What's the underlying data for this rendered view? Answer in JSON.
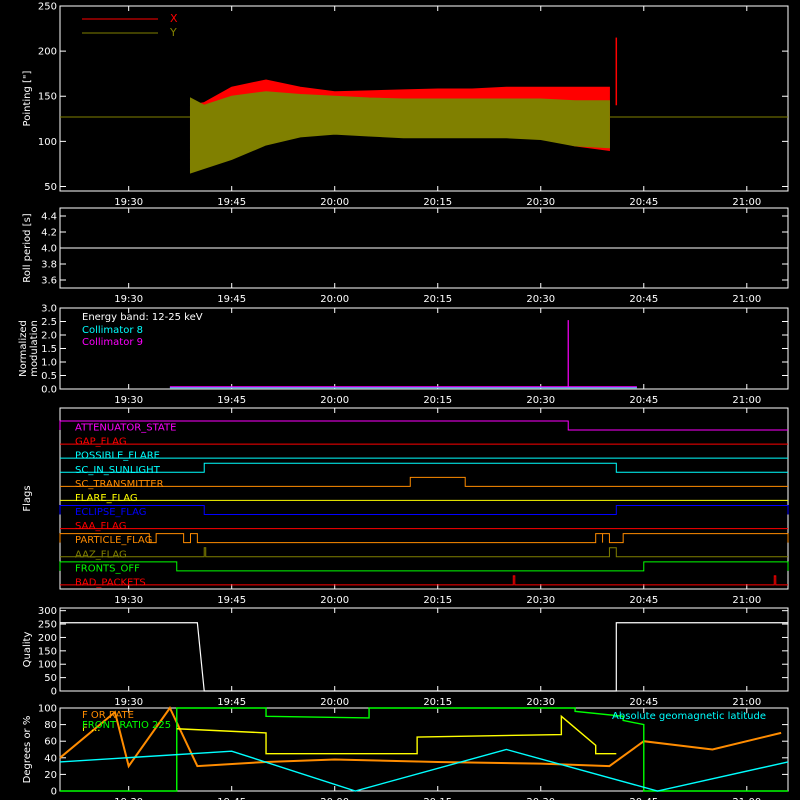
{
  "colors": {
    "background": "#000000",
    "axes": "#ffffff",
    "x": "#ff0000",
    "y": "#808000",
    "cyan": "#00ffff",
    "magenta": "#ff00ff",
    "red": "#ff0000",
    "orange": "#ff8c00",
    "yellow": "#ffff00",
    "blue": "#0000ff",
    "green": "#00ff00",
    "olive": "#808000"
  },
  "chart_data": [
    {
      "type": "area",
      "ylabel": "Pointing [\"]",
      "xlim": [
        "19:20",
        "21:06"
      ],
      "ylim": [
        45,
        250
      ],
      "xticks": [
        "19:30",
        "19:45",
        "20:00",
        "20:15",
        "20:30",
        "20:45",
        "21:00"
      ],
      "yticks": [
        50,
        100,
        150,
        200,
        250
      ],
      "legend": [
        "X",
        "Y"
      ],
      "reference_line": 127,
      "series": [
        {
          "name": "X",
          "color": "#ff0000",
          "x": [
            "19:39",
            "19:41",
            "19:45",
            "19:50",
            "19:55",
            "20:00",
            "20:05",
            "20:10",
            "20:15",
            "20:20",
            "20:25",
            "20:30",
            "20:35",
            "20:40"
          ],
          "upper": [
            140,
            143,
            160,
            168,
            160,
            155,
            156,
            157,
            158,
            158,
            160,
            160,
            160,
            160
          ],
          "lower": [
            75,
            73,
            90,
            102,
            108,
            110,
            108,
            106,
            106,
            106,
            106,
            104,
            95,
            90
          ]
        },
        {
          "name": "Y",
          "color": "#808000",
          "x": [
            "19:39",
            "19:41",
            "19:45",
            "19:50",
            "19:55",
            "20:00",
            "20:05",
            "20:10",
            "20:15",
            "20:20",
            "20:25",
            "20:30",
            "20:35",
            "20:40"
          ],
          "upper": [
            148,
            140,
            150,
            155,
            152,
            150,
            148,
            147,
            147,
            147,
            147,
            147,
            145,
            145
          ],
          "lower": [
            65,
            70,
            80,
            96,
            105,
            108,
            106,
            104,
            104,
            104,
            104,
            102,
            95,
            93
          ]
        }
      ],
      "spike": {
        "x": "20:41",
        "y": 215
      }
    },
    {
      "type": "line",
      "ylabel": "Roll period [s]",
      "xlim": [
        "19:20",
        "21:06"
      ],
      "ylim": [
        3.5,
        4.5
      ],
      "yticks": [
        "3.6",
        "3.8",
        "4.0",
        "4.2",
        "4.4"
      ],
      "xticks": [
        "19:30",
        "19:45",
        "20:00",
        "20:15",
        "20:30",
        "20:45",
        "21:00"
      ],
      "series": [
        {
          "x": [
            "19:20",
            "21:06"
          ],
          "y": [
            4.0,
            4.0
          ]
        }
      ]
    },
    {
      "type": "line",
      "ylabel": "Normalized modulation",
      "ylabel_lines": [
        "Normalized",
        "modulation"
      ],
      "xlim": [
        "19:20",
        "21:06"
      ],
      "ylim": [
        0,
        3.0
      ],
      "yticks": [
        "0.0",
        "0.5",
        "1.0",
        "1.5",
        "2.0",
        "2.5",
        "3.0"
      ],
      "xticks": [
        "19:30",
        "19:45",
        "20:00",
        "20:15",
        "20:30",
        "20:45",
        "21:00"
      ],
      "legend_title": "Energy band: 12-25 keV",
      "series": [
        {
          "name": "Collimator 8",
          "color": "#00ffff",
          "x": [
            "19:36",
            "20:44"
          ],
          "y": [
            0.05,
            0.05
          ]
        },
        {
          "name": "Collimator 9",
          "color": "#ff00ff",
          "x": [
            "19:36",
            "20:34",
            "20:34",
            "20:34",
            "20:44"
          ],
          "y": [
            0.08,
            0.08,
            2.55,
            0.08,
            0.08
          ]
        }
      ]
    },
    {
      "type": "line",
      "ylabel": "Flags",
      "xlim": [
        "19:20",
        "21:06"
      ],
      "xticks": [
        "19:30",
        "19:45",
        "20:00",
        "20:15",
        "20:30",
        "20:45",
        "21:00"
      ],
      "series": [
        {
          "name": "ATTENUATOR_STATE",
          "color": "#ff00ff",
          "on": [
            [
              "19:20",
              "20:34"
            ]
          ]
        },
        {
          "name": "GAP_FLAG",
          "color": "#ff0000",
          "on": []
        },
        {
          "name": "POSSIBLE_FLARE",
          "color": "#00ffff",
          "on": []
        },
        {
          "name": "SC_IN_SUNLIGHT",
          "color": "#00ffff",
          "on": [
            [
              "19:41",
              "20:41"
            ]
          ]
        },
        {
          "name": "SC_TRANSMITTER",
          "color": "#ff8c00",
          "on": [
            [
              "20:11",
              "20:19"
            ]
          ]
        },
        {
          "name": "FLARE_FLAG",
          "color": "#ffff00",
          "on": []
        },
        {
          "name": "ECLIPSE_FLAG",
          "color": "#0000ff",
          "on": [
            [
              "19:20",
              "19:41"
            ],
            [
              "20:41",
              "21:06"
            ]
          ]
        },
        {
          "name": "SAA_FLAG",
          "color": "#ff0000",
          "on": []
        },
        {
          "name": "PARTICLE_FLAG",
          "color": "#ff8c00",
          "on": [
            [
              "19:20",
              "19:33"
            ],
            [
              "19:34",
              "19:38"
            ],
            [
              "19:39",
              "19:40"
            ],
            [
              "20:38",
              "20:39"
            ],
            [
              "20:39",
              "20:40"
            ],
            [
              "20:42",
              "21:06"
            ]
          ]
        },
        {
          "name": "AAZ_FLAG",
          "color": "#808000",
          "on": [
            [
              "19:41",
              "19:41"
            ],
            [
              "20:40",
              "20:41"
            ]
          ]
        },
        {
          "name": "FRONTS_OFF",
          "color": "#00ff00",
          "on": [
            [
              "19:20",
              "19:37"
            ],
            [
              "20:45",
              "21:06"
            ]
          ]
        },
        {
          "name": "BAD_PACKETS",
          "color": "#ff0000",
          "on": [
            [
              "20:26",
              "20:26"
            ],
            [
              "21:04",
              "21:04"
            ]
          ]
        }
      ]
    },
    {
      "type": "line",
      "ylabel": "Quality",
      "xlim": [
        "19:20",
        "21:06"
      ],
      "ylim": [
        0,
        310
      ],
      "yticks": [
        0,
        50,
        100,
        150,
        200,
        250,
        300
      ],
      "xticks": [
        "19:30",
        "19:45",
        "20:00",
        "20:15",
        "20:30",
        "20:45",
        "21:00"
      ],
      "series": [
        {
          "color": "#ffffff",
          "x": [
            "19:20",
            "19:40",
            "19:41",
            "20:41",
            "20:41",
            "21:06"
          ],
          "y": [
            255,
            255,
            0,
            0,
            255,
            255
          ]
        }
      ]
    },
    {
      "type": "line",
      "ylabel": "Degrees or %",
      "xlim": [
        "19:20",
        "21:06"
      ],
      "ylim": [
        0,
        100
      ],
      "yticks": [
        0,
        20,
        40,
        60,
        80,
        100
      ],
      "xticks": [
        "19:30",
        "19:45",
        "20:00",
        "20:15",
        "20:30",
        "20:45",
        "21:00"
      ],
      "legend": [
        "ERROR RATE",
        "LIVETIME",
        "FRONT RATIO 225",
        "Absolute geomagnetic latitude"
      ],
      "legend_visible": [
        "F OR RATE",
        "F ...",
        "FRONT RATIO 225",
        "Absolute geomagnetic latitude"
      ],
      "series": [
        {
          "name": "ERROR RATE",
          "color": "#ff8c00",
          "x": [
            "19:20",
            "19:28",
            "19:30",
            "19:36",
            "19:40",
            "19:50",
            "20:00",
            "20:15",
            "20:30",
            "20:40",
            "20:45",
            "20:55",
            "21:05"
          ],
          "y": [
            40,
            95,
            30,
            100,
            30,
            35,
            38,
            35,
            33,
            30,
            60,
            50,
            70
          ]
        },
        {
          "name": "FRONT RATIO 225",
          "color": "#00ff00",
          "x": [
            "19:20",
            "19:37",
            "19:37",
            "19:50",
            "19:50",
            "20:05",
            "20:05",
            "20:35",
            "20:35",
            "20:42",
            "20:42",
            "20:45",
            "20:45",
            "21:06"
          ],
          "y": [
            0,
            0,
            100,
            100,
            90,
            88,
            100,
            100,
            96,
            90,
            85,
            80,
            0,
            0
          ]
        },
        {
          "name": "LIVETIME",
          "color": "#ffff00",
          "x": [
            "19:37",
            "19:50",
            "19:50",
            "20:12",
            "20:12",
            "20:33",
            "20:33",
            "20:38",
            "20:38",
            "20:41"
          ],
          "y": [
            75,
            70,
            45,
            45,
            65,
            68,
            90,
            55,
            45,
            45
          ]
        },
        {
          "name": "Absolute geomagnetic latitude",
          "color": "#00ffff",
          "x": [
            "19:20",
            "19:45",
            "20:03",
            "20:25",
            "20:47",
            "21:06"
          ],
          "y": [
            35,
            48,
            0,
            50,
            0,
            35
          ]
        }
      ]
    }
  ]
}
